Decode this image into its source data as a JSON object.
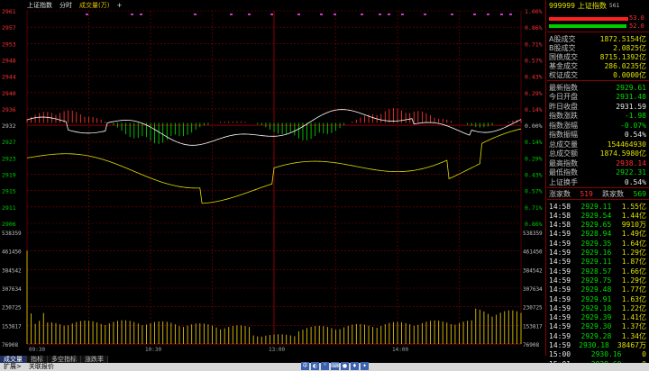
{
  "header": {
    "index_name": "上证指数",
    "mode": "分时",
    "volume_label": "成交量(万)",
    "plus": "+"
  },
  "price_axis": {
    "left": [
      "2961",
      "2957",
      "2953",
      "2948",
      "2944",
      "2940",
      "2936",
      "2932",
      "2927",
      "2923",
      "2919",
      "2915",
      "2911",
      "2906"
    ],
    "right": [
      "1.00%",
      "0.86%",
      "0.71%",
      "0.57%",
      "0.43%",
      "0.29%",
      "0.14%",
      "0.00%",
      "0.14%",
      "0.29%",
      "0.43%",
      "0.57%",
      "0.71%",
      "0.86%"
    ]
  },
  "volume_axis": {
    "left": [
      "538359",
      "461450",
      "384542",
      "307634",
      "230725",
      "153817",
      "76908"
    ],
    "right": [
      "538359",
      "461450",
      "384542",
      "307634",
      "230725",
      "153817",
      "76908"
    ]
  },
  "time_axis": [
    "09:30",
    "10:30",
    "13:00",
    "14:00"
  ],
  "bottom_tabs": [
    "成交量",
    "指标",
    "多空指标",
    "涨跌率"
  ],
  "status_bar": {
    "left1": "扩展>",
    "left2": "关联报价"
  },
  "side": {
    "code": "999999",
    "name": "上证指数",
    "suffix": "561",
    "bar1_value": "53.0",
    "bar2_value": "52.0",
    "turnover_rows": [
      {
        "label": "A股成交",
        "value": "1872.5154亿"
      },
      {
        "label": "B股成交",
        "value": "2.0825亿"
      },
      {
        "label": "国债成交",
        "value": "8715.1392亿"
      },
      {
        "label": "基金成交",
        "value": "286.0235亿"
      },
      {
        "label": "权证成交",
        "value": "0.0000亿"
      }
    ],
    "quote_rows": [
      {
        "label": "最新指数",
        "value": "2929.61",
        "color": "green"
      },
      {
        "label": "今日开盘",
        "value": "2931.48",
        "color": "green"
      },
      {
        "label": "昨日收盘",
        "value": "2931.59",
        "color": "white"
      },
      {
        "label": "指数涨跌",
        "value": "-1.98",
        "color": "green"
      },
      {
        "label": "指数涨幅",
        "value": "-0.07%",
        "color": "green"
      },
      {
        "label": "指数振幅",
        "value": "0.54%",
        "color": "white"
      },
      {
        "label": "总成交量",
        "value": "154464930",
        "color": "yellow"
      },
      {
        "label": "总成交额",
        "value": "1874.5980亿",
        "color": "yellow"
      },
      {
        "label": "最高指数",
        "value": "2938.14",
        "color": "red"
      },
      {
        "label": "最低指数",
        "value": "2922.31",
        "color": "green"
      },
      {
        "label": "上证换手",
        "value": "0.54%",
        "color": "white"
      }
    ],
    "updown": {
      "up_label": "涨家数",
      "up_value": "519",
      "down_label": "跌家数",
      "down_value": "569"
    },
    "ticks": [
      {
        "time": "14:58",
        "price": "2929.11",
        "vol": "1.55亿"
      },
      {
        "time": "14:58",
        "price": "2929.54",
        "vol": "1.44亿"
      },
      {
        "time": "14:58",
        "price": "2929.65",
        "vol": "9910万"
      },
      {
        "time": "14:59",
        "price": "2928.94",
        "vol": "1.49亿"
      },
      {
        "time": "14:59",
        "price": "2929.35",
        "vol": "1.64亿"
      },
      {
        "time": "14:59",
        "price": "2929.16",
        "vol": "1.29亿"
      },
      {
        "time": "14:59",
        "price": "2929.11",
        "vol": "1.87亿"
      },
      {
        "time": "14:59",
        "price": "2928.57",
        "vol": "1.66亿"
      },
      {
        "time": "14:59",
        "price": "2929.75",
        "vol": "1.29亿"
      },
      {
        "time": "14:59",
        "price": "2929.48",
        "vol": "1.77亿"
      },
      {
        "time": "14:59",
        "price": "2929.91",
        "vol": "1.63亿"
      },
      {
        "time": "14:59",
        "price": "2929.18",
        "vol": "1.22亿"
      },
      {
        "time": "14:59",
        "price": "2929.39",
        "vol": "1.41亿"
      },
      {
        "time": "14:59",
        "price": "2929.30",
        "vol": "1.37亿"
      },
      {
        "time": "14:59",
        "price": "2929.28",
        "vol": "1.34亿"
      },
      {
        "time": "14:59",
        "price": "2930.18",
        "vol": "38467万"
      },
      {
        "time": "15:00",
        "price": "2930.16",
        "vol": "0"
      },
      {
        "time": "15:01",
        "price": "2929.60",
        "vol": "0"
      }
    ]
  },
  "colors": {
    "grid": "#8a0000",
    "price_line": "#ffffff",
    "avg_line": "#e0e000",
    "up_bar": "#ff3030",
    "down_bar": "#00cc00",
    "volume_bar": "#e0c000"
  }
}
